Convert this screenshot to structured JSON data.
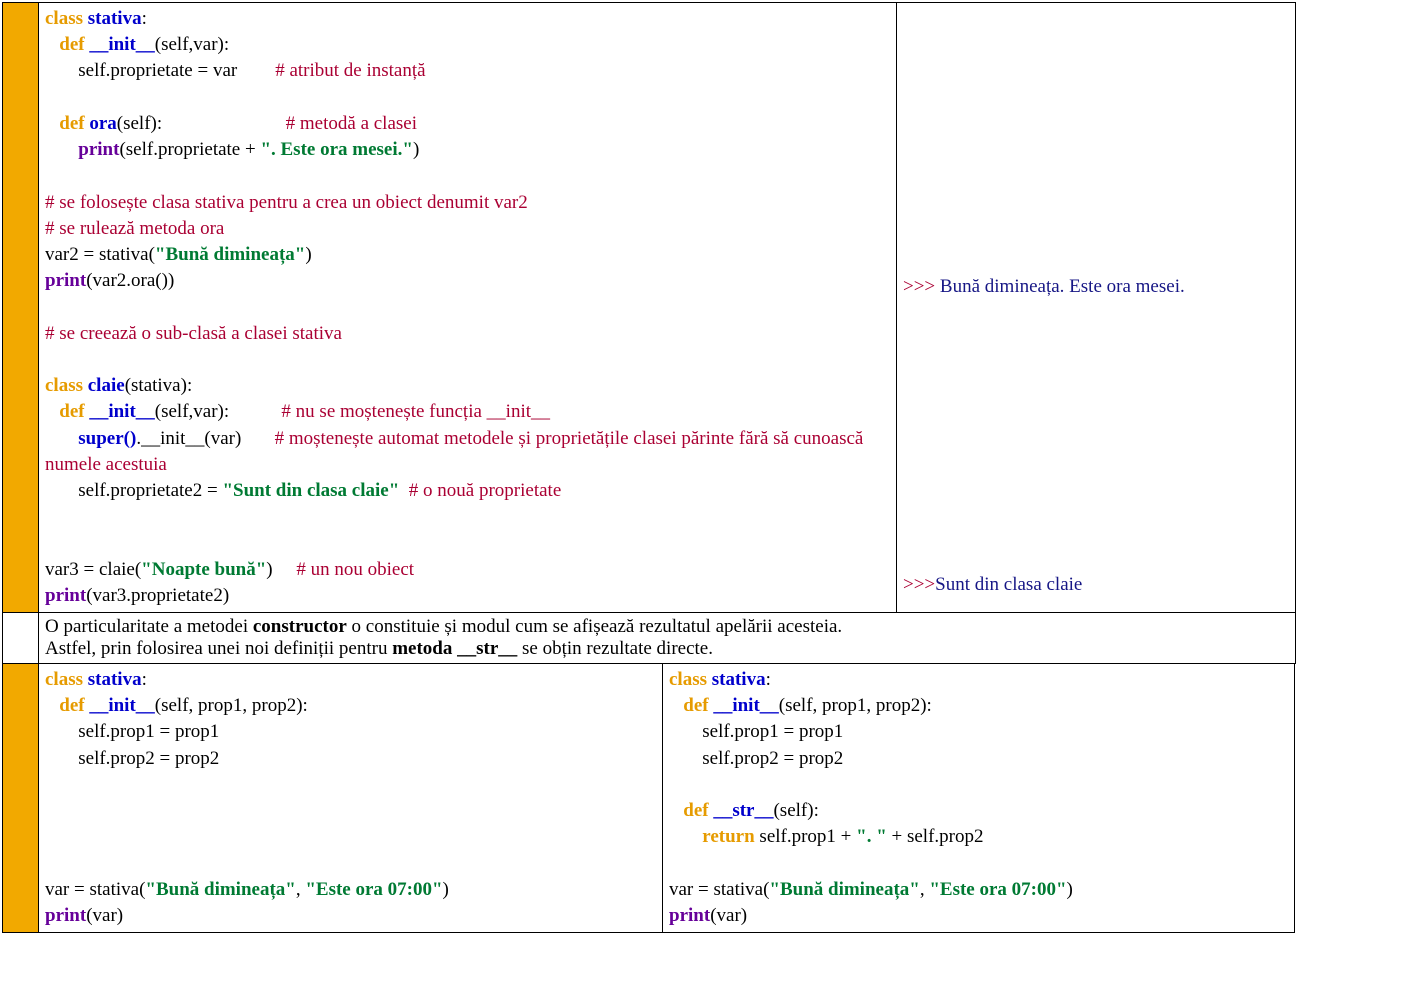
{
  "row1": {
    "code": {
      "l01a": "class",
      "l01b": "stativa",
      "l01c": ":",
      "l02a": "def",
      "l02b": "__init__",
      "l02c": "(self,var):",
      "l03a": "self.proprietate = var",
      "l03b": "# atribut de instanță",
      "l04": "",
      "l05a": "def",
      "l05b": "ora",
      "l05c": "(self):",
      "l05d": "# metodă a clasei",
      "l06a": "print",
      "l06b": "(self.proprietate + ",
      "l06c": "\". Este ora mesei.\"",
      "l06d": ")",
      "l07": "",
      "l08": "# se folosește clasa stativa pentru a crea un obiect denumit var2",
      "l09": "# se rulează metoda ora",
      "l10a": "var2 = stativa(",
      "l10b": "\"Bună dimineața\"",
      "l10c": ")",
      "l11a": "print",
      "l11b": "(var2.ora())",
      "l12": "",
      "l13": "# se creează o sub-clasă a clasei stativa",
      "l14": "",
      "l15a": "class",
      "l15b": "claie",
      "l15c": "(stativa):",
      "l16a": "def",
      "l16b": "__init__",
      "l16c": "(self,var):",
      "l16d": "# nu se moștenește funcția __init__",
      "l17a": "super()",
      "l17b": ".__init__(var)",
      "l17c": "# moștenește automat metodele și proprietățile clasei părinte fără să cunoască numele acestuia",
      "l18a": "self.proprietate2 = ",
      "l18b": "\"Sunt din clasa claie\"",
      "l18c": "# o nouă proprietate",
      "l19": "",
      "l20": "",
      "l21a": "var3 = claie(",
      "l21b": "\"Noapte bună\"",
      "l21c": ")",
      "l21d": "# un nou obiect",
      "l22a": "print",
      "l22b": "(var3.proprietate2)"
    },
    "output": {
      "o1a": ">>> ",
      "o1b": "Bună dimineața. Este ora mesei.",
      "o2a": ">>>",
      "o2b": "Sunt din clasa claie"
    }
  },
  "row2": {
    "p1a": "O particularitate a metodei ",
    "p1b": "constructor",
    "p1c": " o constituie și modul cum se afișează rezultatul apelării acesteia.",
    "p2a": "Astfel, prin folosirea unei noi definiții pentru ",
    "p2b": "metoda __str__",
    "p2c": " se obțin rezultate directe."
  },
  "row3": {
    "left": {
      "l01a": "class",
      "l01b": "stativa",
      "l01c": ":",
      "l02a": "def",
      "l02b": "__init__",
      "l02c": "(self, prop1, prop2):",
      "l03": "self.prop1 = prop1",
      "l04": "self.prop2 = prop2",
      "l05": "",
      "l06": "",
      "l07": "",
      "l08": "",
      "l09a": "var = stativa(",
      "l09b": "\"Bună dimineața\"",
      "l09c": ", ",
      "l09d": "\"Este ora 07:00\"",
      "l09e": ")",
      "l10a": "print",
      "l10b": "(var)"
    },
    "right": {
      "l01a": "class",
      "l01b": "stativa",
      "l01c": ":",
      "l02a": "def",
      "l02b": "__init__",
      "l02c": "(self, prop1, prop2):",
      "l03": "self.prop1 = prop1",
      "l04": "self.prop2 = prop2",
      "l05": "",
      "l06a": "def",
      "l06b": "__str__",
      "l06c": "(self):",
      "l07a": "return",
      "l07b": " self.prop1 + ",
      "l07c": "\". \"",
      "l07d": " + self.prop2",
      "l08": "",
      "l09a": "var = stativa(",
      "l09b": "\"Bună dimineața\"",
      "l09c": ", ",
      "l09d": "\"Este ora 07:00\"",
      "l09e": ")",
      "l10a": "print",
      "l10b": "(var)"
    }
  }
}
